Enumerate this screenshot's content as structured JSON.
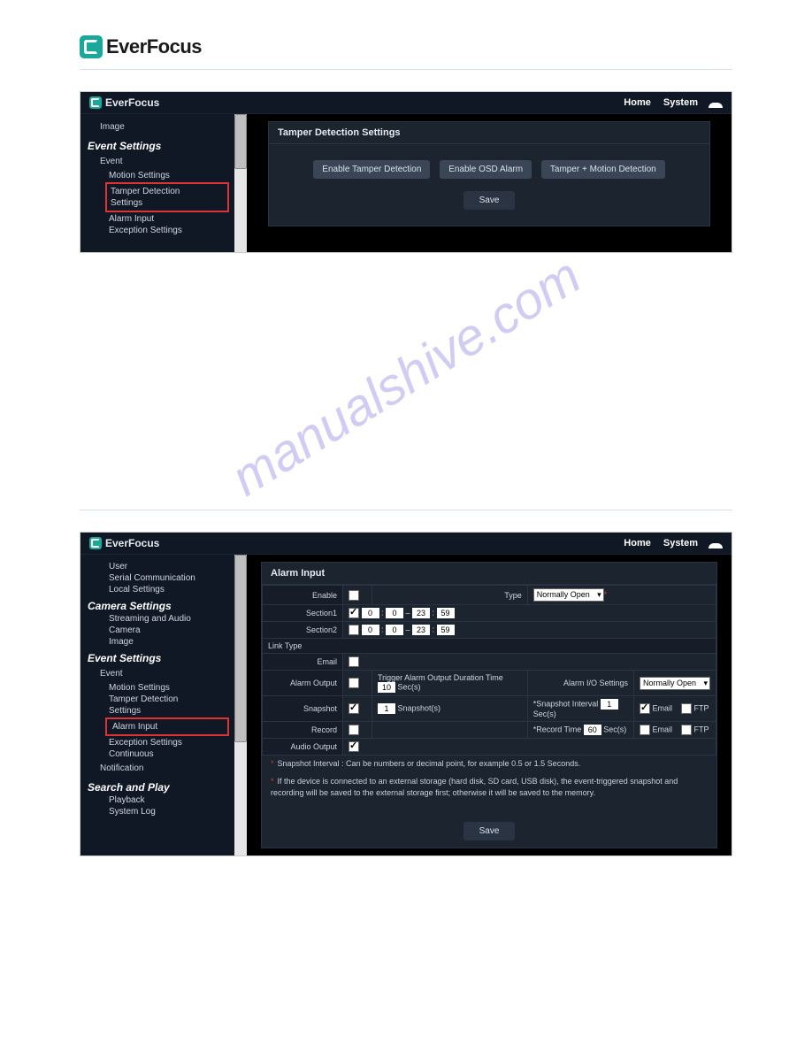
{
  "brand": "EverFocus",
  "watermark": "manualshive.com",
  "topbar": {
    "home": "Home",
    "system": "System"
  },
  "shot1": {
    "side": {
      "image": "Image",
      "event_settings": "Event Settings",
      "event": "Event",
      "motion": "Motion Settings",
      "tamper_l1": "Tamper Detection",
      "tamper_l2": "Settings",
      "alarm_input": "Alarm Input",
      "exception": "Exception Settings"
    },
    "panel_title": "Tamper Detection Settings",
    "btn1": "Enable Tamper Detection",
    "btn2": "Enable OSD Alarm",
    "btn3": "Tamper + Motion Detection",
    "save": "Save"
  },
  "shot2": {
    "side": {
      "user": "User",
      "serial": "Serial Communication",
      "local": "Local Settings",
      "camera_settings": "Camera Settings",
      "streaming": "Streaming and Audio",
      "camera": "Camera",
      "image": "Image",
      "event_settings": "Event Settings",
      "event": "Event",
      "motion": "Motion Settings",
      "tamper": "Tamper Detection",
      "settings": "Settings",
      "alarm_input": "Alarm Input",
      "exception": "Exception Settings",
      "continuous": "Continuous",
      "notification": "Notification",
      "search_play": "Search and Play",
      "playback": "Playback",
      "syslog": "System Log"
    },
    "panel_title": "Alarm Input",
    "rows": {
      "enable": "Enable",
      "type": "Type",
      "type_val": "Normally Open",
      "section1": "Section1",
      "s1a": "0",
      "s1b": "0",
      "s1c": "23",
      "s1d": "59",
      "section2": "Section2",
      "s2a": "0",
      "s2b": "0",
      "s2c": "23",
      "s2d": "59",
      "link_type": "Link Type",
      "email": "Email",
      "alarm_output": "Alarm Output",
      "trig_lbl": "Trigger Alarm Output Duration Time",
      "trig_val": "10",
      "trig_unit": "Sec(s)",
      "aio": "Alarm I/O Settings",
      "aio_val": "Normally Open",
      "snapshot": "Snapshot",
      "snap_n": "1",
      "snap_unit": "Snapshot(s)",
      "snap_int_lbl": "*Snapshot Interval",
      "snap_int_val": "1",
      "snap_int_unit": "Sec(s)",
      "cb_email": "Email",
      "cb_ftp": "FTP",
      "record": "Record",
      "rec_lbl": "*Record Time",
      "rec_val": "60",
      "rec_unit": "Sec(s)",
      "audio": "Audio Output"
    },
    "note1": "Snapshot Interval : Can be numbers or decimal point, for example 0.5 or 1.5 Seconds.",
    "note2": "If the device is connected to an external storage (hard disk, SD card, USB disk), the event-triggered snapshot and recording will be saved to the external storage first; otherwise it will be saved to the memory.",
    "save": "Save"
  }
}
